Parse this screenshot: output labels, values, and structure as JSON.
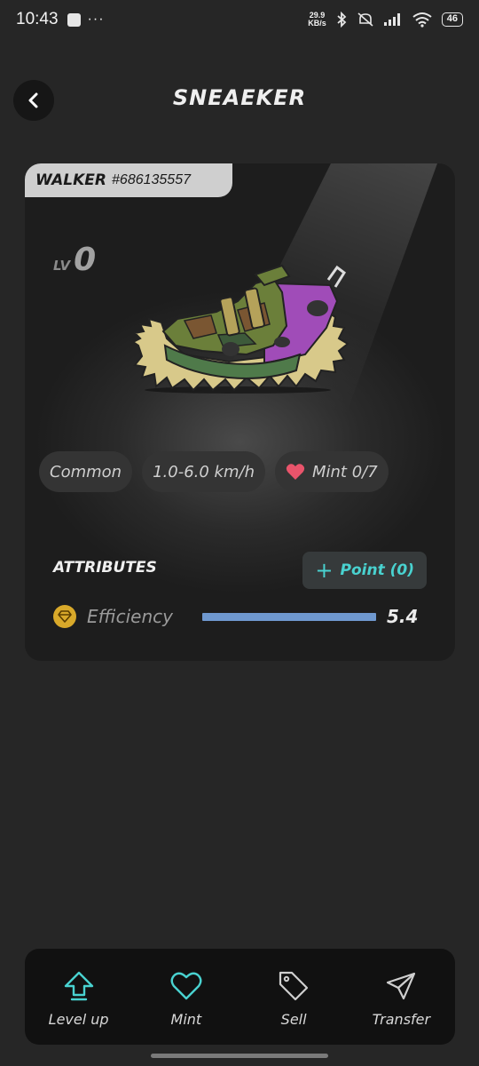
{
  "status_bar": {
    "time": "10:43",
    "dots": "···",
    "net_speed_value": "29.9",
    "net_speed_unit": "KB/s",
    "battery": "46"
  },
  "header": {
    "title": "SNEAEKER"
  },
  "card": {
    "type": "WALKER",
    "id": "#686135557",
    "lv_label": "LV",
    "lv_value": "0",
    "pills": {
      "rarity": "Common",
      "speed": "1.0-6.0 km/h",
      "mint": "Mint 0/7"
    },
    "attributes": {
      "title": "ATTRIBUTES",
      "point_button": "Point (0)",
      "efficiency": {
        "label": "Efficiency",
        "value": "5.4",
        "bar_fraction": 1.0
      }
    }
  },
  "bottom_nav": {
    "items": [
      {
        "label": "Level up",
        "icon": "arrow-up-icon"
      },
      {
        "label": "Mint",
        "icon": "heart-icon"
      },
      {
        "label": "Sell",
        "icon": "tag-icon"
      },
      {
        "label": "Transfer",
        "icon": "send-icon"
      }
    ]
  },
  "colors": {
    "accent": "#49d2d0",
    "efficiency_icon": "#d9a92a",
    "bar_fill": "#6f98cf",
    "heart": "#e9546b"
  }
}
